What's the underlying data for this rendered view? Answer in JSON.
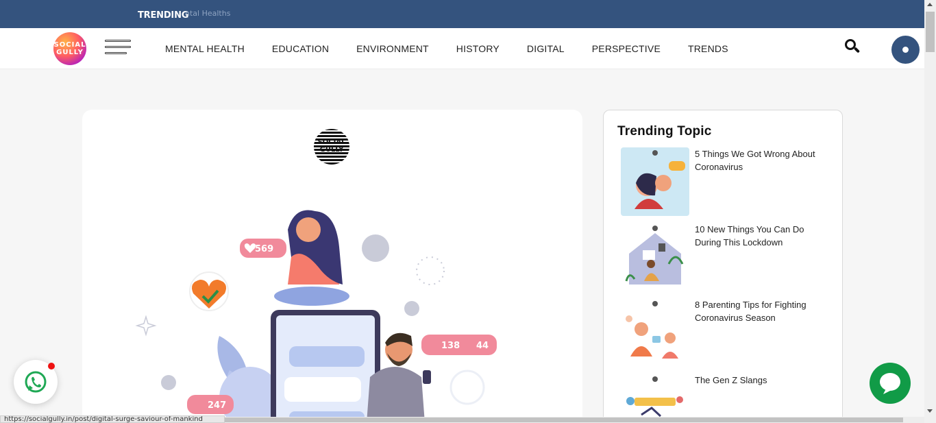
{
  "ticker": {
    "label": "TRENDING",
    "scrolling_text": "ntal Healths"
  },
  "nav": {
    "logo_text": "SOCIAL GULLY",
    "menu": [
      "MENTAL HEALTH",
      "EDUCATION",
      "ENVIRONMENT",
      "HISTORY",
      "DIGITAL",
      "PERSPECTIVE",
      "TRENDS"
    ],
    "search_icon": "search-icon",
    "user_icon": "user-icon"
  },
  "article": {
    "brand_text": "SOCIAL GULLY",
    "illustration": {
      "likes": "569",
      "hearts": "138",
      "followers": "44",
      "comments": "247"
    }
  },
  "sidebar": {
    "title": "Trending Topic",
    "topics": [
      {
        "title": "5 Things We Got Wrong About Coronavirus"
      },
      {
        "title": "10 New Things You Can Do During This Lockdown"
      },
      {
        "title": "8 Parenting Tips for Fighting Coronavirus Season"
      },
      {
        "title": "The Gen Z Slangs"
      }
    ]
  },
  "status_bar": {
    "url": "https://socialgully.in/post/digital-surge-saviour-of-mankind"
  },
  "floating": {
    "whatsapp_icon": "whatsapp-icon",
    "chat_icon": "chat-icon"
  },
  "colors": {
    "brand": "#34537e",
    "whatsapp": "#119b47",
    "notification": "#ee1111"
  }
}
